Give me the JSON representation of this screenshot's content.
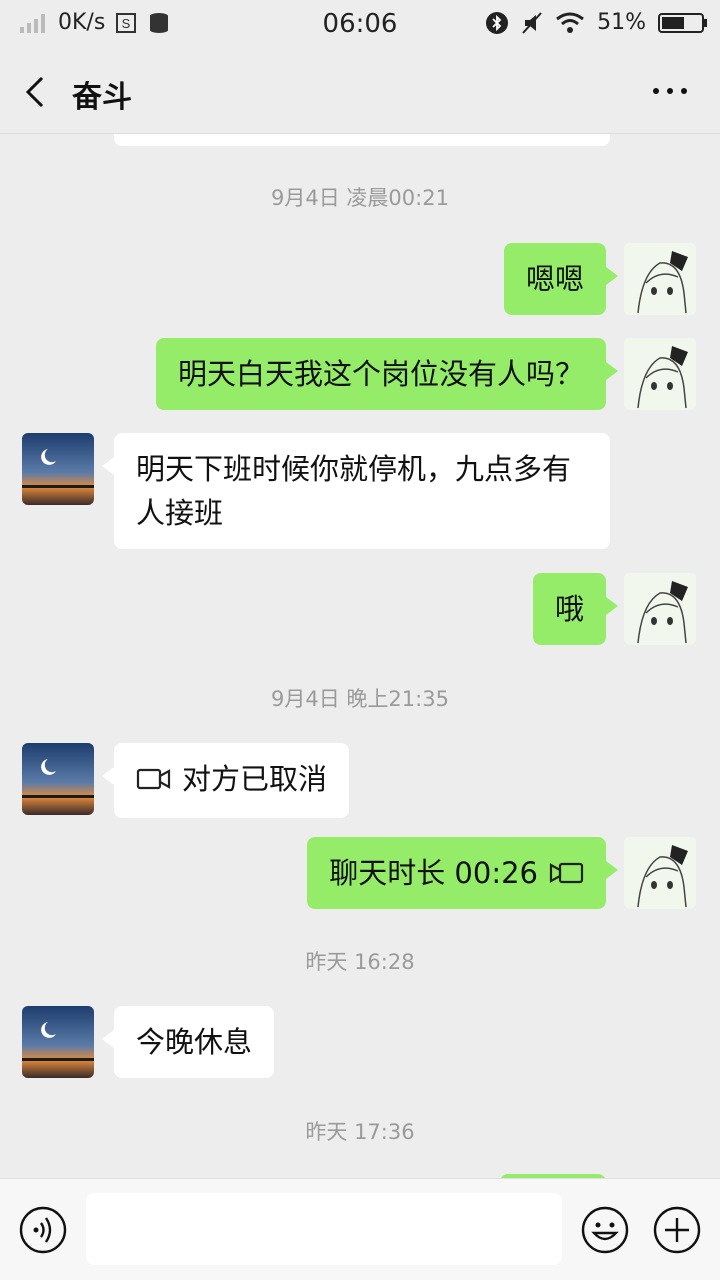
{
  "status_bar": {
    "net_speed": "0K/s",
    "time": "06:06",
    "battery_pct": "51%"
  },
  "header": {
    "back_icon": "chevron-left-icon",
    "title": "奋斗",
    "more_icon": "more-dots-icon"
  },
  "messages": [
    {
      "kind": "time",
      "text": "9月4日 凌晨00:21"
    },
    {
      "kind": "msg",
      "from": "me",
      "text": "嗯嗯"
    },
    {
      "kind": "msg",
      "from": "me",
      "text": "明天白天我这个岗位没有人吗？"
    },
    {
      "kind": "msg",
      "from": "other",
      "text": "明天下班时候你就停机，九点多有人接班"
    },
    {
      "kind": "msg",
      "from": "me",
      "text": "哦"
    },
    {
      "kind": "time",
      "text": "9月4日 晚上21:35"
    },
    {
      "kind": "msg",
      "from": "other",
      "text": "对方已取消",
      "icon": "video-call-icon"
    },
    {
      "kind": "msg",
      "from": "me",
      "text": "聊天时长 00:26",
      "icon": "video-call-icon"
    },
    {
      "kind": "time",
      "text": "昨天 16:28"
    },
    {
      "kind": "msg",
      "from": "other",
      "text": "今晚休息"
    },
    {
      "kind": "time",
      "text": "昨天 17:36"
    }
  ],
  "bottom_bar": {
    "voice_icon": "voice-input-icon",
    "emoji_icon": "emoji-icon",
    "plus_icon": "plus-icon",
    "input_value": ""
  },
  "colors": {
    "background": "#ededed",
    "my_bubble": "#95ec69",
    "other_bubble": "#ffffff",
    "timestamp": "#9a9a9a"
  }
}
